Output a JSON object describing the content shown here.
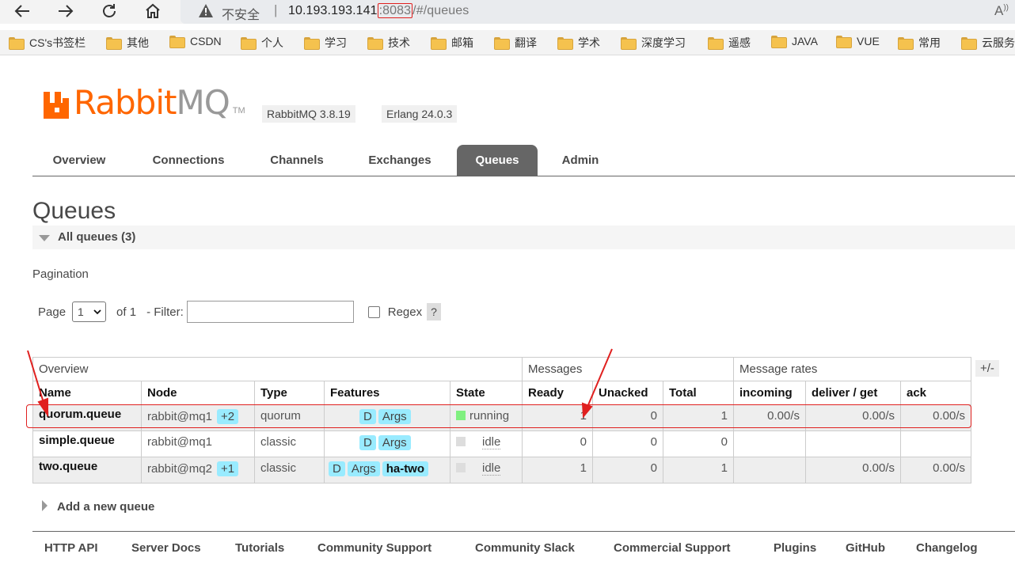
{
  "browser": {
    "insecure_label": "不安全",
    "separator": "|",
    "url_host": "10.193.193.141",
    "url_port": ":8083",
    "url_path": "/#/queues",
    "bookmarks": [
      "CS's书签栏",
      "其他",
      "CSDN",
      "个人",
      "学习",
      "技术",
      "邮箱",
      "翻译",
      "学术",
      "深度学习",
      "遥感",
      "JAVA",
      "VUE",
      "常用",
      "云服务"
    ]
  },
  "header": {
    "logo_rabbit": "Rabbit",
    "logo_mq": "MQ",
    "logo_tm": "TM",
    "rabbitmq_version": "RabbitMQ 3.8.19",
    "erlang_version": "Erlang 24.0.3"
  },
  "tabs": [
    "Overview",
    "Connections",
    "Channels",
    "Exchanges",
    "Queues",
    "Admin"
  ],
  "page": {
    "title": "Queues",
    "section": "All queues (3)",
    "pagination_label": "Pagination",
    "page_label": "Page",
    "page_value": "1",
    "of_label": "of 1",
    "filter_label": "- Filter:",
    "filter_value": "",
    "regex_label": "Regex",
    "help_label": "?",
    "toggle_columns": "+/-",
    "add_queue": "Add a new queue"
  },
  "table": {
    "groups": [
      "Overview",
      "Messages",
      "Message rates"
    ],
    "headers": [
      "Name",
      "Node",
      "Type",
      "Features",
      "State",
      "Ready",
      "Unacked",
      "Total",
      "incoming",
      "deliver / get",
      "ack"
    ],
    "rows": [
      {
        "name": "quorum.queue",
        "node": "rabbit@mq1",
        "node_extra": "+2",
        "type": "quorum",
        "features": [
          "D",
          "Args"
        ],
        "state": "running",
        "ready": "1",
        "unacked": "0",
        "total": "1",
        "incoming": "0.00/s",
        "deliver": "0.00/s",
        "ack": "0.00/s"
      },
      {
        "name": "simple.queue",
        "node": "rabbit@mq1",
        "node_extra": "",
        "type": "classic",
        "features": [
          "D",
          "Args"
        ],
        "state": "idle",
        "ready": "0",
        "unacked": "0",
        "total": "0",
        "incoming": "",
        "deliver": "",
        "ack": ""
      },
      {
        "name": "two.queue",
        "node": "rabbit@mq2",
        "node_extra": "+1",
        "type": "classic",
        "features": [
          "D",
          "Args",
          "ha-two"
        ],
        "state": "idle",
        "ready": "1",
        "unacked": "0",
        "total": "1",
        "incoming": "",
        "deliver": "0.00/s",
        "ack": "0.00/s"
      }
    ]
  },
  "footer": [
    "HTTP API",
    "Server Docs",
    "Tutorials",
    "Community Support",
    "Community Slack",
    "Commercial Support",
    "Plugins",
    "GitHub",
    "Changelog"
  ],
  "colors": {
    "brand_orange": "#ff6600",
    "running_green": "#80f080",
    "idle_grey": "#dddddd",
    "pill_blue": "#99ebff",
    "annotation_red": "#e0201f"
  }
}
